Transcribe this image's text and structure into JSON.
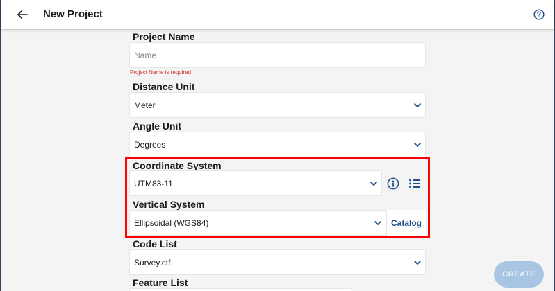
{
  "appbar": {
    "title": "New Project",
    "back_icon": "arrow-left-icon",
    "help_icon": "help-circle-icon"
  },
  "form": {
    "project_name": {
      "label": "Project Name",
      "placeholder": "Name",
      "value": "",
      "error": "Project Name is required"
    },
    "distance_unit": {
      "label": "Distance Unit",
      "value": "Meter"
    },
    "angle_unit": {
      "label": "Angle Unit",
      "value": "Degrees"
    },
    "coordinate_system": {
      "label": "Coordinate System",
      "value": "UTM83-11",
      "info_icon": "info-circle-icon",
      "list_icon": "list-icon"
    },
    "vertical_system": {
      "label": "Vertical System",
      "value": "Ellipsoidal (WGS84)",
      "catalog_label": "Catalog"
    },
    "code_list": {
      "label": "Code List",
      "value": "Survey.ctf"
    },
    "feature_list": {
      "label": "Feature List"
    }
  },
  "actions": {
    "create_label": "CREATE"
  },
  "colors": {
    "accent": "#1f4f8a",
    "error": "#d32f2f",
    "highlight": "#ff0000",
    "create_disabled": "#a9c5e4"
  }
}
